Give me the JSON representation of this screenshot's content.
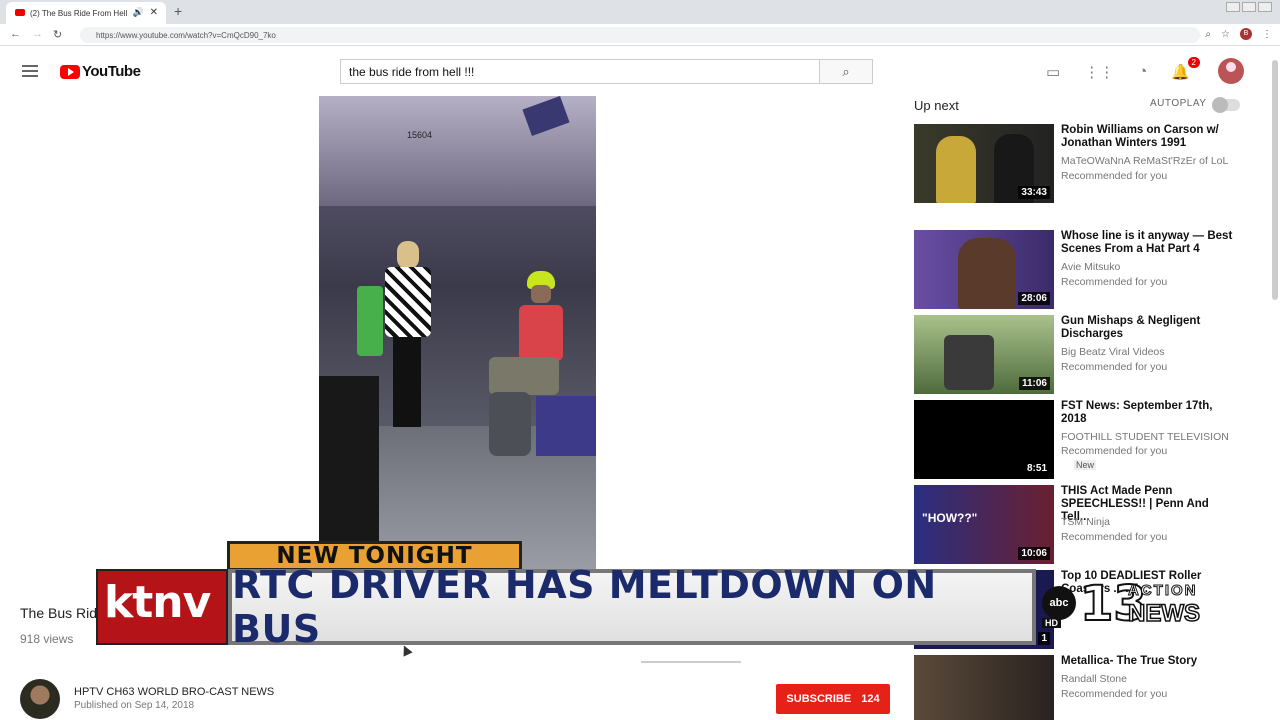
{
  "browser": {
    "tab_title": "(2) The Bus Ride From Hell",
    "new_tab": "+",
    "url": "https://www.youtube.com/watch?v=CmQcD90_7ko",
    "profile_initial": "B"
  },
  "header": {
    "logo_text": "YouTube",
    "search_value": "the bus ride from hell !!!",
    "notification_count": "2"
  },
  "video": {
    "bus_number": "15604",
    "title": "The Bus Rid",
    "views": "918 views",
    "channel": "HPTV CH63 WORLD BRO-CAST NEWS",
    "published": "Published on Sep 14, 2018",
    "subscribe_label": "SUBSCRIBE",
    "subscriber_count": "124"
  },
  "sidebar": {
    "up_next": "Up next",
    "autoplay": "AUTOPLAY",
    "items": [
      {
        "title": "Robin Williams on Carson w/ Jonathan Winters 1991",
        "channel": "MaTeOWaNnA ReMaSt'RzEr of LoL",
        "meta": "Recommended for you",
        "duration": "33:43"
      },
      {
        "title": "Whose line is it anyway — Best Scenes From a Hat Part 4",
        "channel": "Avie Mitsuko",
        "meta": "Recommended for you",
        "duration": "28:06"
      },
      {
        "title": "Gun Mishaps & Negligent Discharges",
        "channel": "Big Beatz Viral Videos",
        "meta": "Recommended for you",
        "duration": "11:06"
      },
      {
        "title": "FST News: September 17th, 2018",
        "channel": "FOOTHILL STUDENT TELEVISION",
        "meta": "Recommended for you",
        "badge": "New",
        "duration": "8:51"
      },
      {
        "title": "THIS Act Made Penn SPEECHLESS!! | Penn And Tell...",
        "channel": "TSM Ninja",
        "meta": "Recommended for you",
        "duration": "10:06",
        "thumb_text": "\"HOW??\""
      },
      {
        "title": "Top 10 DEADLIEST Roller Coasters ...YE...",
        "channel": "",
        "meta": "",
        "duration": "1"
      },
      {
        "title": "Metallica- The True Story",
        "channel": "Randall Stone",
        "meta": "Recommended for you",
        "duration": ""
      }
    ]
  },
  "overlay": {
    "tag": "NEW TONIGHT",
    "station_logo": "ktnv",
    "headline": "RTC DRIVER HAS MELTDOWN ON BUS",
    "network": "abc",
    "hd": "HD",
    "channel_num": "13",
    "action": "ACTION",
    "news": "NEWS"
  }
}
